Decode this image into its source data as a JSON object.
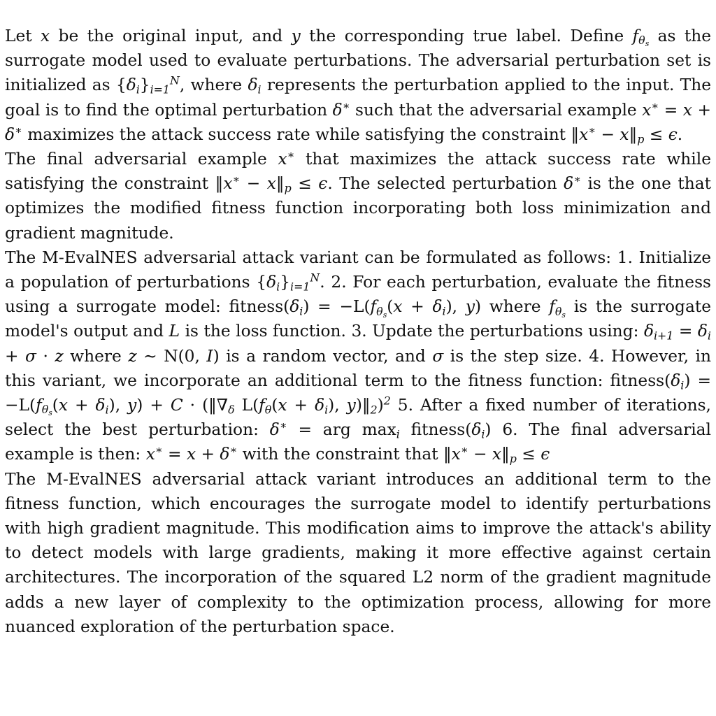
{
  "paragraphs": [
    {
      "text": "Let x be the original input, and y the corresponding true label. Define f_{θ_s} as the surrogate model used to evaluate perturbations. The adversarial perturbation set is initialized as {δ_i}_{i=1}^N, where δ_i represents the perturbation applied to the input. The goal is to find the optimal perturbation δ* such that the adversarial example x* = x + δ* maximizes the attack success rate while satisfying the constraint ‖x* − x‖_p ≤ ϵ."
    },
    {
      "text": "The final adversarial example x* that maximizes the attack success rate while satisfying the constraint ‖x* − x‖_p ≤ ϵ. The selected perturbation δ* is the one that optimizes the modified fitness function incorporating both loss minimization and gradient magnitude."
    },
    {
      "text": "The M-EvalNES adversarial attack variant can be formulated as follows: 1. Initialize a population of perturbations {δ_i}_{i=1}^N. 2. For each perturbation, evaluate the fitness using a surrogate model: fitness(δ_i) = −L(f_{θ_s}(x + δ_i), y) where f_{θ_s} is the surrogate model's output and L is the loss function. 3. Update the perturbations using: δ_{i+1} = δ_i + σ · z where z ∼ N(0, I) is a random vector, and σ is the step size. 4. However, in this variant, we incorporate an additional term to the fitness function: fitness(δ_i) = −L(f_{θ_s}(x + δ_i), y) + C · (‖∇_δ L(f_θ(x + δ_i), y)‖_2)^2 5. After a fixed number of iterations, select the best perturbation: δ* = arg max_i fitness(δ_i) 6. The final adversarial example is then: x* = x + δ* with the constraint that ‖x* − x‖_p ≤ ϵ"
    },
    {
      "text": "The M-EvalNES adversarial attack variant introduces an additional term to the fitness function, which encourages the surrogate model to identify perturbations with high gradient magnitude. This modification aims to improve the attack's ability to detect models with large gradients, making it more effective against certain architectures. The incorporation of the squared L2 norm of the gradient magnitude adds a new layer of complexity to the optimization process, allowing for more nuanced exploration of the perturbation space."
    }
  ]
}
